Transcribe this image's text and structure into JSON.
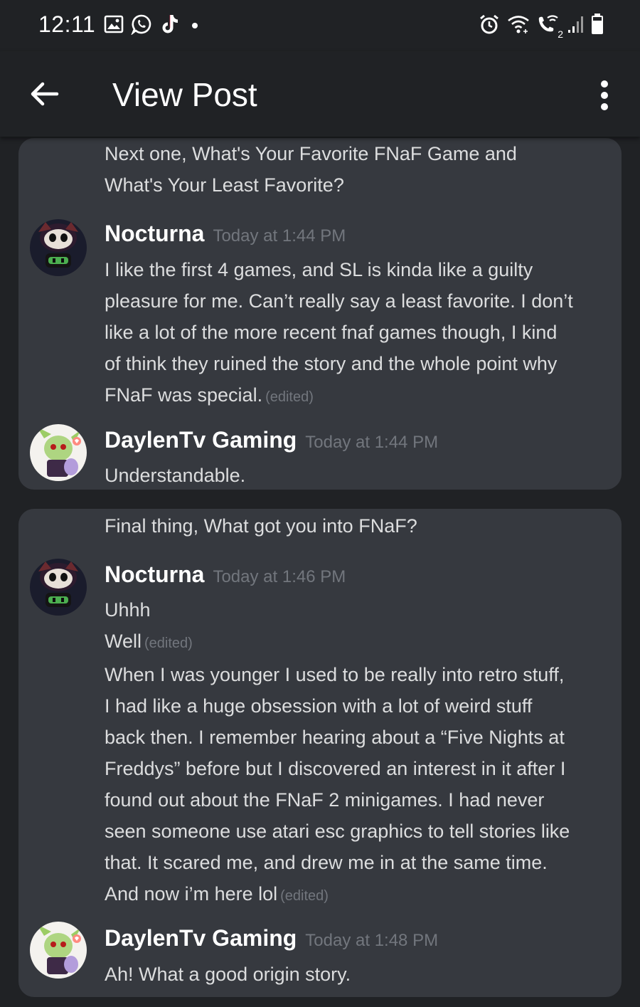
{
  "status_bar": {
    "time": "12:11",
    "left_icons": [
      "gallery-icon",
      "whatsapp-icon",
      "tiktok-icon",
      "dot-icon"
    ],
    "right_icons": [
      "alarm-icon",
      "wifi-icon",
      "wifi-call-icon",
      "signal-icon",
      "battery-icon"
    ],
    "sim_label": "2"
  },
  "app_bar": {
    "title": "View Post",
    "back_icon": "arrow-left-icon",
    "menu_icon": "more-vertical-icon"
  },
  "colors": {
    "background": "#202225",
    "card": "#36393f",
    "text": "#dcddde",
    "muted": "#72767d",
    "name": "#ffffff"
  },
  "posts": [
    {
      "question_lines": [
        "Next one, What's Your Favorite FNaF Game and",
        "What's Your Least Favorite?"
      ],
      "messages": [
        {
          "author": "Nocturna",
          "timestamp": "Today at 1:44 PM",
          "avatar": "nocturna-avatar",
          "paragraphs": [
            {
              "lines": [
                "I like the first 4 games, and SL is kinda like a guilty",
                "pleasure for me. Can’t really say a least favorite. I don’t",
                "like a lot of the more recent fnaf games though, I kind",
                "of think they ruined the story and the whole point why",
                "FNaF was special."
              ],
              "edited": "(edited)"
            }
          ]
        },
        {
          "author": "DaylenTv Gaming",
          "timestamp": "Today at 1:44 PM",
          "avatar": "daylen-avatar",
          "paragraphs": [
            {
              "lines": [
                "Understandable."
              ]
            }
          ]
        }
      ]
    },
    {
      "question_lines": [
        "Final thing, What got you into FNaF?"
      ],
      "messages": [
        {
          "author": "Nocturna",
          "timestamp": "Today at 1:46 PM",
          "avatar": "nocturna-avatar",
          "paragraphs": [
            {
              "lines": [
                "Uhhh"
              ]
            },
            {
              "lines": [
                "Well"
              ],
              "edited": "(edited)"
            },
            {
              "lines": [
                "When I was younger I used to be really into retro stuff,",
                "I had like a huge obsession with a lot of weird stuff",
                "back then. I remember hearing about a “Five Nights at",
                "Freddys” before but I discovered an interest in it after I",
                "found out about the FNaF 2 minigames. I had never",
                "seen someone use atari esc graphics to tell stories like",
                "that. It scared me, and drew me in at the same time.",
                "And now i’m here lol"
              ],
              "edited": "(edited)"
            }
          ]
        },
        {
          "author": "DaylenTv Gaming",
          "timestamp": "Today at 1:48 PM",
          "avatar": "daylen-avatar",
          "paragraphs": [
            {
              "lines": [
                "Ah! What a good origin story."
              ]
            }
          ]
        }
      ]
    }
  ]
}
